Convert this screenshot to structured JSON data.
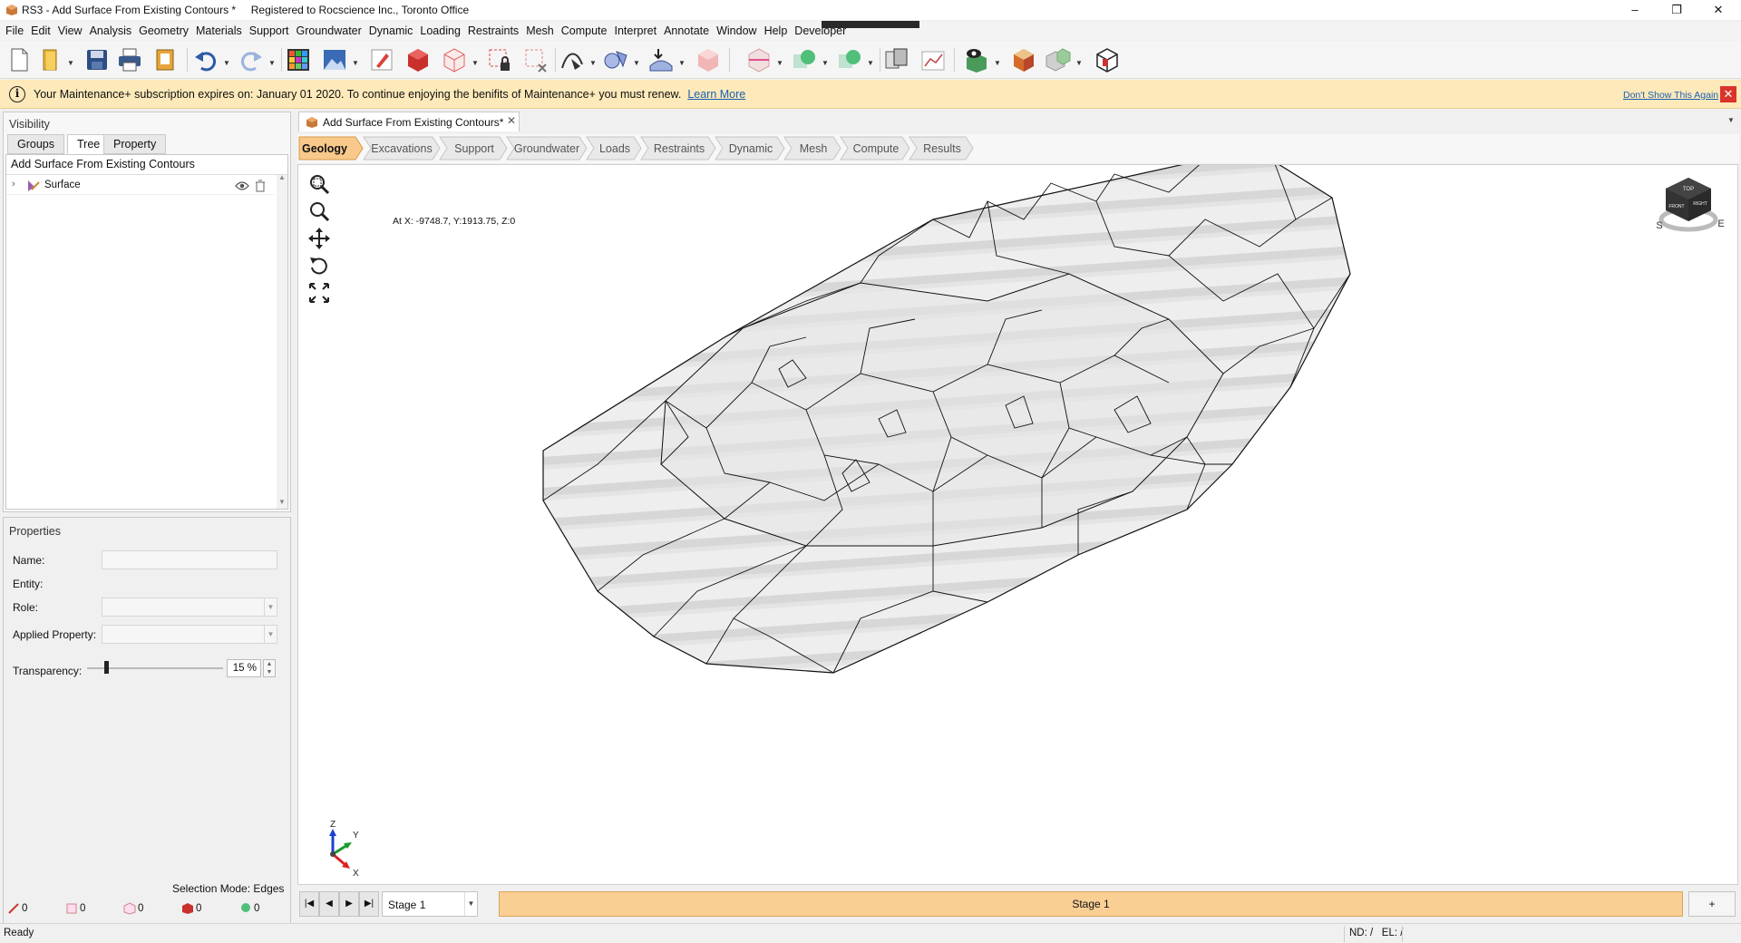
{
  "window": {
    "title": "RS3 - Add Surface From Existing Contours *     Registered to Rocscience Inc., Toronto Office",
    "minimize": "–",
    "restore": "❐",
    "close": "✕"
  },
  "menu": [
    "File",
    "Edit",
    "View",
    "Analysis",
    "Geometry",
    "Materials",
    "Support",
    "Groundwater",
    "Dynamic",
    "Loading",
    "Restraints",
    "Mesh",
    "Compute",
    "Interpret",
    "Annotate",
    "Window",
    "Help",
    "Developer"
  ],
  "notice": {
    "message": "Your Maintenance+ subscription expires on: January 01 2020. To continue enjoying the benifits of Maintenance+ you must renew.",
    "learn_more": "Learn More",
    "dont_show": "Don't Show This Again"
  },
  "visibility": {
    "title": "Visibility",
    "tabs": [
      "Groups",
      "Tree",
      "Property"
    ],
    "active_tab": "Tree",
    "tree_header": "Add Surface From Existing Contours",
    "tree_items": [
      {
        "label": "Surface"
      }
    ]
  },
  "properties": {
    "title": "Properties",
    "name_label": "Name:",
    "entity_label": "Entity:",
    "role_label": "Role:",
    "applied_property_label": "Applied Property:",
    "transparency_label": "Transparency:",
    "transparency_value": "15 %",
    "selection_mode": "Selection Mode: Edges",
    "counters": [
      "0",
      "0",
      "0",
      "0",
      "0"
    ]
  },
  "document_tab": {
    "label": "Add Surface From Existing Contours*"
  },
  "workflow": {
    "steps": [
      "Geology",
      "Excavations",
      "Support",
      "Groundwater",
      "Loads",
      "Restraints",
      "Dynamic",
      "Mesh",
      "Compute",
      "Results"
    ],
    "active": "Geology"
  },
  "viewport": {
    "coordinate_readout": "At X: -9748.7, Y:1913.75, Z:0",
    "view_cube": {
      "top": "TOP",
      "front": "FRONT",
      "right": "RIGHT",
      "compass_s": "S",
      "compass_e": "E"
    },
    "axes": {
      "x": "X",
      "y": "Y",
      "z": "Z"
    }
  },
  "stage": {
    "selected": "Stage 1",
    "bar_label": "Stage 1",
    "add": "+"
  },
  "status": {
    "left": "Ready",
    "right": "ND: /   EL: /"
  },
  "colors": {
    "accent_orange": "#f9c98b",
    "notice_bg": "#fde9b9",
    "stage_bar": "#f9cf94",
    "link": "#1a5fb4"
  }
}
